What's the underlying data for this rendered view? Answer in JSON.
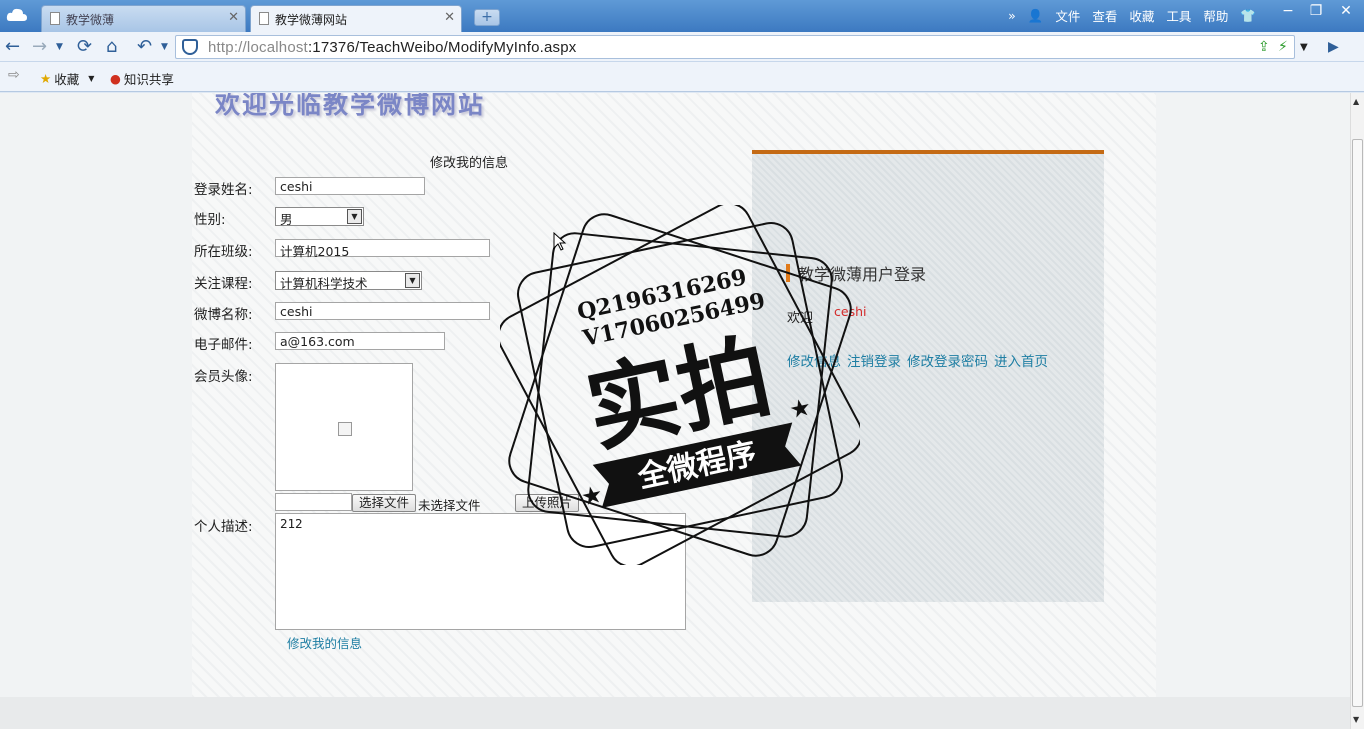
{
  "browser": {
    "tabs": [
      {
        "label": "教学微薄",
        "active": false
      },
      {
        "label": "教学微薄网站",
        "active": true
      }
    ],
    "menu": [
      "文件",
      "查看",
      "收藏",
      "工具",
      "帮助"
    ],
    "url_host": "http://localhost",
    "url_rest": ":17376/TeachWeibo/ModifyMyInfo.aspx",
    "favorites": [
      {
        "label": "收藏",
        "icon": "star-icon"
      },
      {
        "label": "知识共享",
        "icon": "share-icon"
      }
    ]
  },
  "site": {
    "title": "欢迎光临教学微博网站"
  },
  "form": {
    "heading": "修改我的信息",
    "fields": {
      "login_name_label": "登录姓名:",
      "login_name": "ceshi",
      "gender_label": "性别:",
      "gender": "男",
      "class_label": "所在班级:",
      "class": "计算机2015",
      "course_label": "关注课程:",
      "course": "计算机科学技术",
      "weibo_name_label": "微博名称:",
      "weibo_name": "ceshi",
      "email_label": "电子邮件:",
      "email": "a@163.com",
      "avatar_label": "会员头像:",
      "choose_file": "选择文件",
      "no_file": "未选择文件",
      "upload": "上传照片",
      "desc_label": "个人描述:",
      "desc": "212"
    },
    "submit_link": "修改我的信息"
  },
  "login_panel": {
    "title": "教学微薄用户登录",
    "welcome": "欢迎",
    "username": "ceshi",
    "links": [
      "修改信息",
      "注销登录",
      "修改登录密码",
      "进入首页"
    ]
  },
  "watermark": {
    "line1": "Q2196316269",
    "line2": "V17060256499",
    "big": "实拍",
    "ribbon": "全微程序"
  },
  "colors": {
    "accent": "#c46a14",
    "link": "#1e7ea3",
    "username": "#d42a2a"
  }
}
